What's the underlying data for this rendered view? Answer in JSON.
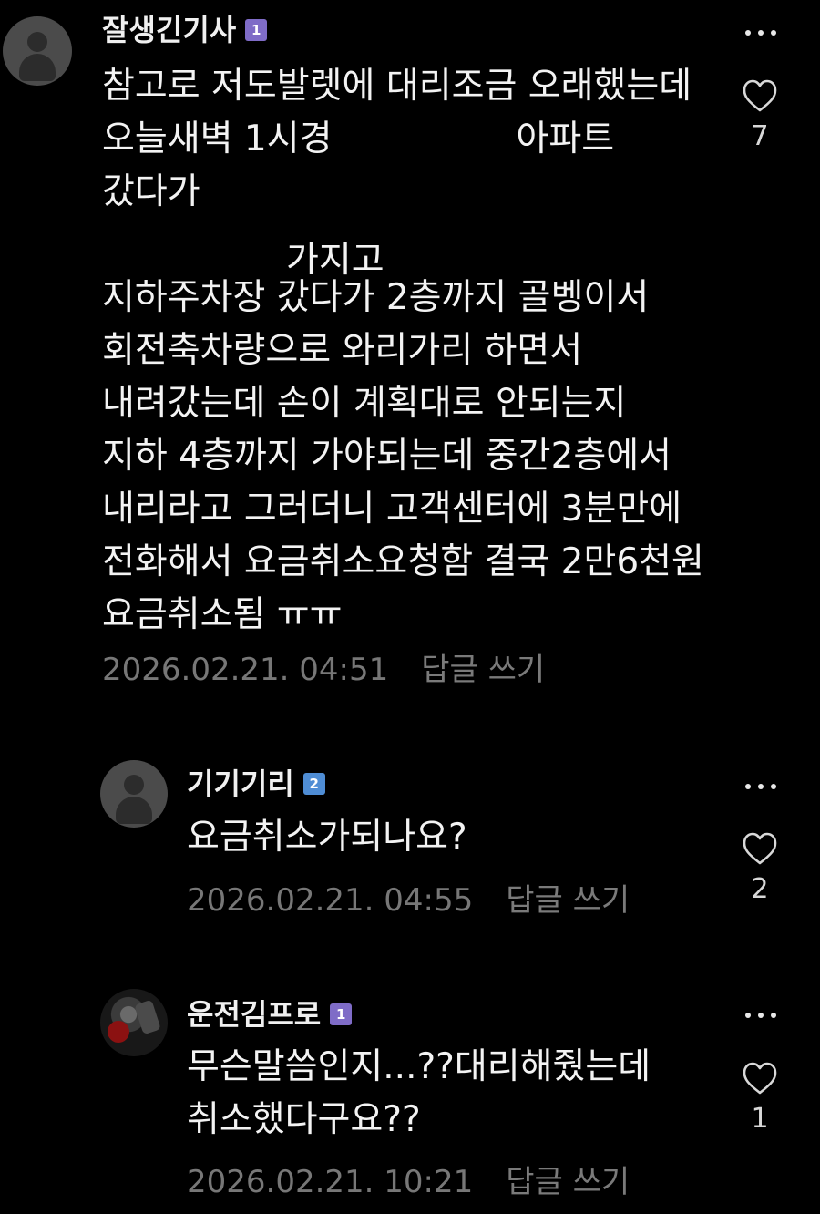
{
  "comments": [
    {
      "username": "잘생긴기사",
      "level": "1",
      "text_lines": [
        "참고로 저도발렛에 대리조금 오래했는데",
        {
          "before": "오늘새벽 1시경",
          "after": "아파트"
        },
        "갔다가",
        {
          "before": "",
          "after": "가지고"
        },
        "지하주차장 갔다가 2층까지 골벵이서",
        "회전축차량으로 와리가리 하면서",
        "내려갔는데 손이 계획대로 안되는지",
        "지하 4층까지 가야되는데 중간2층에서",
        "내리라고 그러더니 고객센터에 3분만에",
        "전화해서 요금취소요청함 결국 2만6천원",
        "요금취소됨 ㅠㅠ"
      ],
      "timestamp": "2026.02.21. 04:51",
      "reply_label": "답글 쓰기",
      "likes": "7"
    },
    {
      "username": "기기기리",
      "level": "2",
      "text_lines": [
        "요금취소가되나요?"
      ],
      "timestamp": "2026.02.21. 04:55",
      "reply_label": "답글 쓰기",
      "likes": "2"
    },
    {
      "username": "운전김프로",
      "level": "1",
      "text_lines": [
        "무슨말씀인지...??대리해줬는데",
        "취소했다구요??"
      ],
      "timestamp": "2026.02.21. 10:21",
      "reply_label": "답글 쓰기",
      "likes": "1"
    }
  ],
  "icons": {
    "more": "more-icon",
    "heart": "heart-icon",
    "avatar": "avatar-icon"
  },
  "colors": {
    "background": "#000000",
    "text": "#f3f3f3",
    "meta": "#777777",
    "level_1": "#7f6cc7",
    "level_2": "#4f8dd5"
  }
}
